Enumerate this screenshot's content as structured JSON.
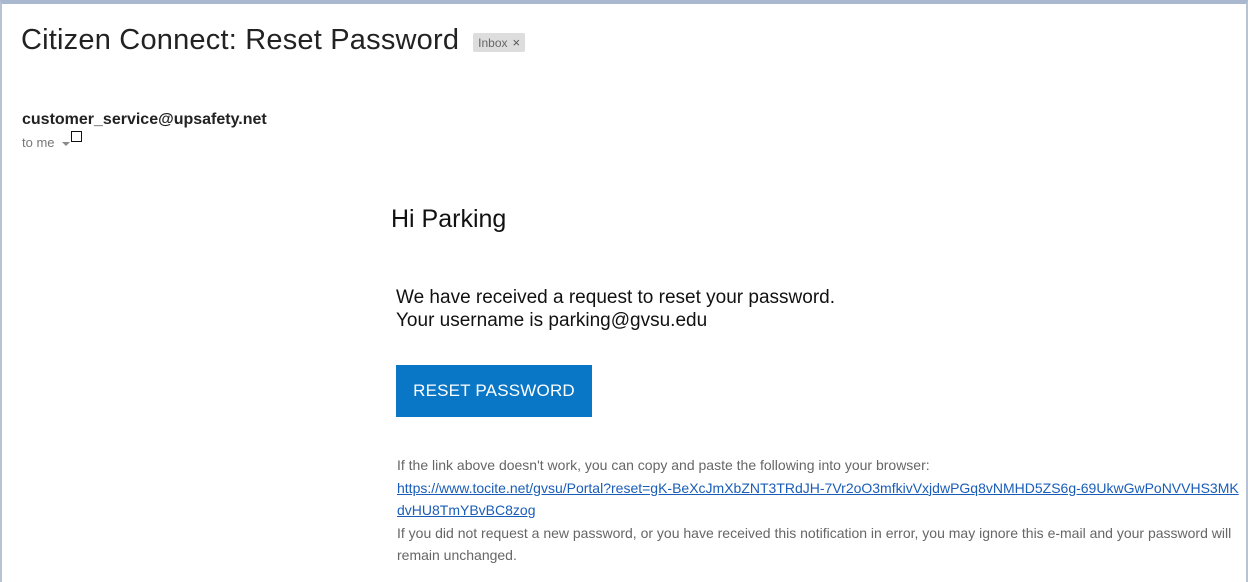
{
  "email": {
    "subject": "Citizen Connect: Reset Password",
    "label": "Inbox",
    "label_close": "×",
    "sender": "customer_service@upsafety.net",
    "recipient": "to me"
  },
  "body": {
    "greeting": "Hi Parking",
    "line1": "We have received a request to reset your password.",
    "line2": "Your username is parking@gvsu.edu",
    "button_label": "RESET PASSWORD",
    "copy_instruction": "If the link above doesn't work, you can copy and paste the following into your browser:",
    "reset_url": "https://www.tocite.net/gvsu/Portal?reset=gK-BeXcJmXbZNT3TRdJH-7Vr2oO3mfkivVxjdwPGq8vNMHD5ZS6g-69UkwGwPoNVVHS3MKdvHU8TmYBvBC8zog",
    "disclaimer": "If you did not request a new password, or you have received this notification in error, you may ignore this e-mail and your password will remain unchanged."
  },
  "colors": {
    "button": "#0a76c6",
    "link": "#1a5db8",
    "muted_text": "#666666"
  },
  "icons": {
    "recipient_dropdown": "chevron-down-icon",
    "unknown_glyph": "empty-square-icon"
  }
}
